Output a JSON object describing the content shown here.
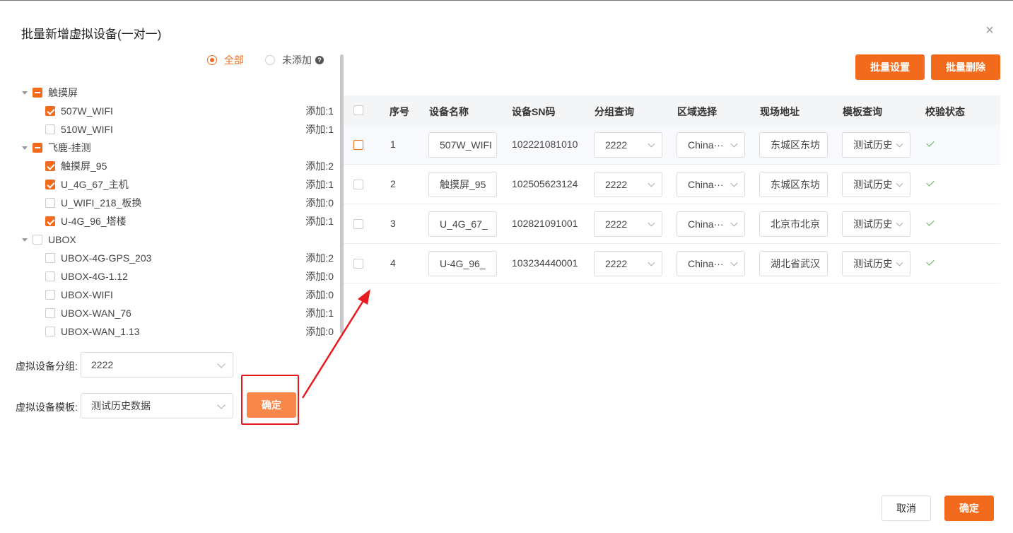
{
  "dialog": {
    "title": "批量新增虚拟设备(一对一)",
    "close": "×"
  },
  "filter": {
    "all": "全部",
    "not_added": "未添加",
    "help": "?"
  },
  "tree": [
    {
      "label": "触摸屏",
      "level": 0,
      "state": "indet"
    },
    {
      "label": "507W_WIFI",
      "level": 1,
      "state": "checked",
      "count": "添加:1"
    },
    {
      "label": "510W_WIFI",
      "level": 1,
      "state": "none",
      "count": "添加:1"
    },
    {
      "label": "飞鹿-挂测",
      "level": 0,
      "state": "indet"
    },
    {
      "label": "触摸屏_95",
      "level": 1,
      "state": "checked",
      "count": "添加:2"
    },
    {
      "label": "U_4G_67_主机",
      "level": 1,
      "state": "checked",
      "count": "添加:1"
    },
    {
      "label": "U_WIFI_218_板换",
      "level": 1,
      "state": "none",
      "count": "添加:0"
    },
    {
      "label": "U-4G_96_塔楼",
      "level": 1,
      "state": "checked",
      "count": "添加:1"
    },
    {
      "label": "UBOX",
      "level": 0,
      "state": "none"
    },
    {
      "label": "UBOX-4G-GPS_203",
      "level": 1,
      "state": "none",
      "count": "添加:2"
    },
    {
      "label": "UBOX-4G-1.12",
      "level": 1,
      "state": "none",
      "count": "添加:0"
    },
    {
      "label": "UBOX-WIFI",
      "level": 1,
      "state": "none",
      "count": "添加:0"
    },
    {
      "label": "UBOX-WAN_76",
      "level": 1,
      "state": "none",
      "count": "添加:1"
    },
    {
      "label": "UBOX-WAN_1.13",
      "level": 1,
      "state": "none",
      "count": "添加:0"
    }
  ],
  "form": {
    "group_label": "虚拟设备分组:",
    "group_value": "2222",
    "template_label": "虚拟设备模板:",
    "template_value": "测试历史数据",
    "confirm": "确定"
  },
  "toolbar": {
    "batch_set": "批量设置",
    "batch_delete": "批量删除"
  },
  "table": {
    "headers": [
      "序号",
      "设备名称",
      "设备SN码",
      "分组查询",
      "区域选择",
      "现场地址",
      "模板查询",
      "校验状态"
    ],
    "rows": [
      {
        "no": "1",
        "name": "507W_WIFI",
        "sn": "102221081010",
        "group": "2222",
        "region": "China···",
        "address": "东城区东坊",
        "template": "测试历史",
        "valid": true
      },
      {
        "no": "2",
        "name": "触摸屏_95",
        "sn": "102505623124",
        "group": "2222",
        "region": "China···",
        "address": "东城区东坊",
        "template": "测试历史",
        "valid": true
      },
      {
        "no": "3",
        "name": "U_4G_67_",
        "sn": "102821091001",
        "group": "2222",
        "region": "China···",
        "address": "北京市北京",
        "template": "测试历史",
        "valid": true
      },
      {
        "no": "4",
        "name": "U-4G_96_",
        "sn": "103234440001",
        "group": "2222",
        "region": "China···",
        "address": "湖北省武汉",
        "template": "测试历史",
        "valid": true
      }
    ]
  },
  "footer": {
    "cancel": "取消",
    "confirm": "确定"
  },
  "colors": {
    "accent": "#f26b1d",
    "annotation": "#e8191f",
    "valid": "#52b05a"
  }
}
